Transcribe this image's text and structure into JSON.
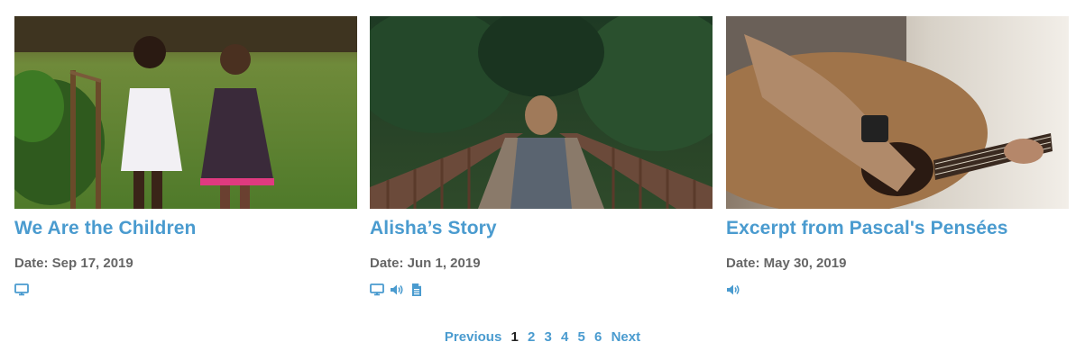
{
  "posts": [
    {
      "title": "We Are the Children",
      "date": "Date: Sep 17, 2019",
      "image": "children-holding-hands-photo",
      "media": [
        "monitor-icon"
      ]
    },
    {
      "title": "Alisha’s Story",
      "date": "Date: Jun 1, 2019",
      "image": "woman-on-bridge-photo",
      "media": [
        "monitor-icon",
        "speaker-icon",
        "document-icon"
      ]
    },
    {
      "title": "Excerpt from Pascal's Pensées",
      "date": "Date: May 30, 2019",
      "image": "guitar-player-photo",
      "media": [
        "speaker-icon"
      ]
    }
  ],
  "pagination": {
    "previous": "Previous",
    "pages": [
      "1",
      "2",
      "3",
      "4",
      "5",
      "6"
    ],
    "current": "1",
    "next": "Next"
  },
  "colors": {
    "link": "#4a9bcf",
    "date": "#666666",
    "current_page": "#222222"
  }
}
